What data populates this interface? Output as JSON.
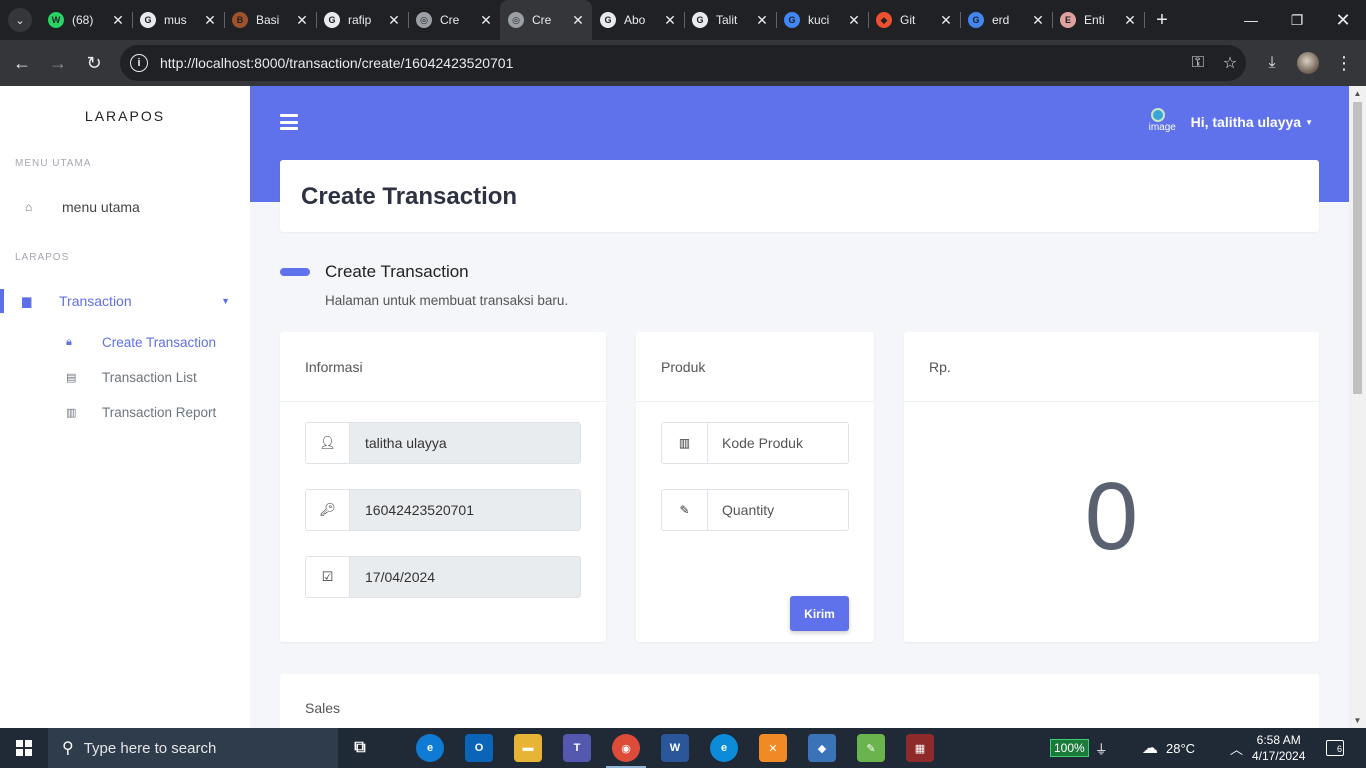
{
  "browser": {
    "tabs": [
      {
        "title": "(68)",
        "color": "#25D366",
        "glyph": "W"
      },
      {
        "title": "mus",
        "color": "#e8eaed",
        "glyph": "G"
      },
      {
        "title": "Basi",
        "color": "#a0522d",
        "glyph": "B"
      },
      {
        "title": "rafip",
        "color": "#e8eaed",
        "glyph": "G"
      },
      {
        "title": "Cre",
        "color": "#9aa0a6",
        "glyph": "◎"
      },
      {
        "title": "Cre",
        "color": "#9aa0a6",
        "glyph": "◎"
      },
      {
        "title": "Abo",
        "color": "#e8eaed",
        "glyph": "G"
      },
      {
        "title": "Talit",
        "color": "#e8eaed",
        "glyph": "G"
      },
      {
        "title": "kuci",
        "color": "#4285F4",
        "glyph": "G"
      },
      {
        "title": "Git",
        "color": "#F05032",
        "glyph": "◆"
      },
      {
        "title": "erd",
        "color": "#4285F4",
        "glyph": "G"
      },
      {
        "title": "Enti",
        "color": "#e0a0a0",
        "glyph": "E"
      }
    ],
    "url": "http://localhost:8000/transaction/create/16042423520701"
  },
  "sidebar": {
    "brand": "LARAPOS",
    "heading_main": "MENU UTAMA",
    "menu_main": "menu utama",
    "heading_app": "LARAPOS",
    "transaction": "Transaction",
    "sub": {
      "create": "Create Transaction",
      "list": "Transaction List",
      "report": "Transaction Report"
    }
  },
  "header": {
    "avatar_alt": "image",
    "greeting": "Hi, talitha ulayya"
  },
  "page": {
    "title": "Create Transaction",
    "section_title": "Create Transaction",
    "section_subtitle": "Halaman untuk membuat transaksi baru."
  },
  "informasi": {
    "label": "Informasi",
    "user": "talitha ulayya",
    "code": "16042423520701",
    "date": "17/04/2024"
  },
  "produk": {
    "label": "Produk",
    "kode_placeholder": "Kode Produk",
    "qty_placeholder": "Quantity",
    "submit": "Kirim"
  },
  "total": {
    "label": "Rp.",
    "value": "0"
  },
  "sales": {
    "label": "Sales"
  },
  "taskbar": {
    "search_placeholder": "Type here to search",
    "battery": "100%",
    "temperature": "28°C",
    "time": "6:58 AM",
    "date": "4/17/2024",
    "notifications": "6"
  },
  "colors": {
    "accent": "#5f72eb",
    "sidebar_active": "#5f6fe8"
  }
}
